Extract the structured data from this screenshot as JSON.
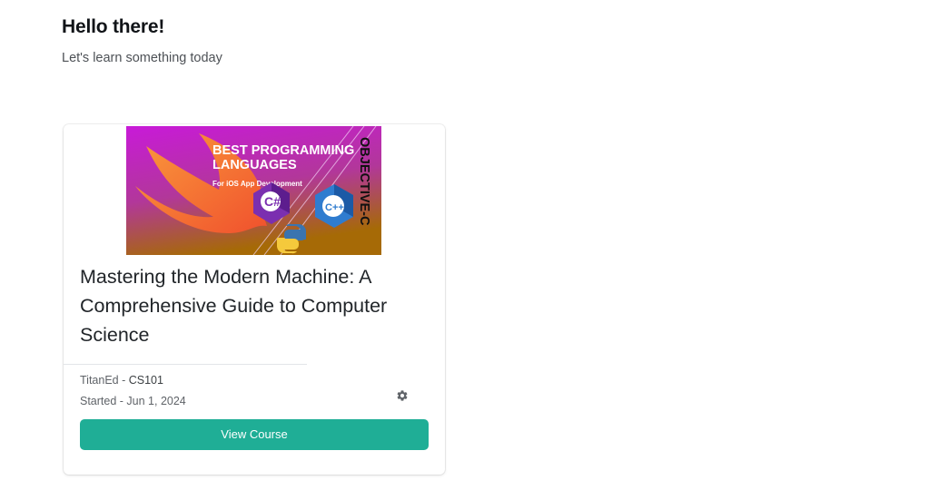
{
  "header": {
    "greeting": "Hello there!",
    "subtitle": "Let's learn something today"
  },
  "course_card": {
    "thumbnail": {
      "headline_line1": "BEST PROGRAMMING",
      "headline_line2": "LANGUAGES",
      "tagline": "For iOS App Development",
      "side_text": "OBJECTIVE-C",
      "csharp_glyph": "C#",
      "cpp_glyph": "C++"
    },
    "title": "Mastering the Modern Machine: A Comprehensive Guide to Computer Science",
    "org": "TitanEd",
    "org_separator": " - ",
    "code": "CS101",
    "started_label": "Started - ",
    "started_date": "Jun 1, 2024",
    "settings_icon": "gear-icon",
    "button_label": "View Course"
  },
  "colors": {
    "accent": "#1fae96",
    "thumb_top": "#c21ad6",
    "thumb_bottom": "#b06a08"
  }
}
